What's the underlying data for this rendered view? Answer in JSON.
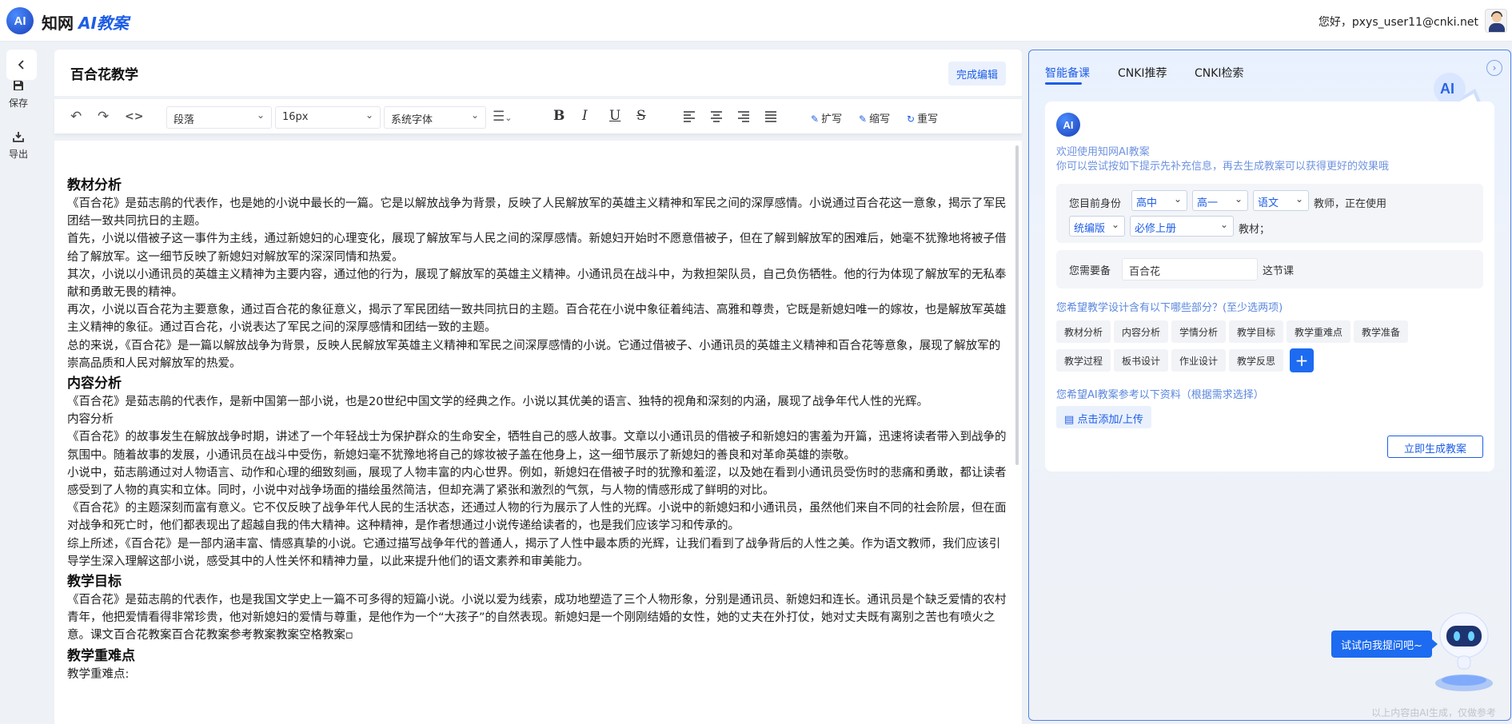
{
  "header": {
    "brand_cn": "知网",
    "brand_ai": "AI",
    "brand_suffix": "教案",
    "logo_text": "AI",
    "greeting": "您好，pxys_user11@cnki.net"
  },
  "leftrail": {
    "back": "<",
    "items": [
      {
        "label": "保存"
      },
      {
        "label": "导出"
      }
    ]
  },
  "editor": {
    "title": "百合花教学",
    "done_label": "完成编辑",
    "toolbar": {
      "paragraph": "段落",
      "font_size": "16px",
      "font_family": "系统字体",
      "expand": "扩写",
      "shorten": "缩写",
      "rewrite": "重写"
    },
    "blocks": [
      {
        "type": "h",
        "text": "教材分析"
      },
      {
        "type": "p",
        "text": "《百合花》是茹志鹃的代表作，也是她的小说中最长的一篇。它是以解放战争为背景，反映了人民解放军的英雄主义精神和军民之间的深厚感情。小说通过百合花这一意象，揭示了军民团结一致共同抗日的主题。"
      },
      {
        "type": "p",
        "text": "首先，小说以借被子这一事件为主线，通过新媳妇的心理变化，展现了解放军与人民之间的深厚感情。新媳妇开始时不愿意借被子，但在了解到解放军的困难后，她毫不犹豫地将被子借给了解放军。这一细节反映了新媳妇对解放军的深深同情和热爱。"
      },
      {
        "type": "p",
        "text": "其次，小说以小通讯员的英雄主义精神为主要内容，通过他的行为，展现了解放军的英雄主义精神。小通讯员在战斗中，为救担架队员，自己负伤牺牲。他的行为体现了解放军的无私奉献和勇敢无畏的精神。"
      },
      {
        "type": "p",
        "text": "再次，小说以百合花为主要意象，通过百合花的象征意义，揭示了军民团结一致共同抗日的主题。百合花在小说中象征着纯洁、高雅和尊贵，它既是新媳妇唯一的嫁妆，也是解放军英雄主义精神的象征。通过百合花，小说表达了军民之间的深厚感情和团结一致的主题。"
      },
      {
        "type": "p",
        "text": "总的来说，《百合花》是一篇以解放战争为背景，反映人民解放军英雄主义精神和军民之间深厚感情的小说。它通过借被子、小通讯员的英雄主义精神和百合花等意象，展现了解放军的崇高品质和人民对解放军的热爱。"
      },
      {
        "type": "h",
        "text": "内容分析"
      },
      {
        "type": "p",
        "text": "《百合花》是茹志鹃的代表作，是新中国第一部小说，也是20世纪中国文学的经典之作。小说以其优美的语言、独特的视角和深刻的内涵，展现了战争年代人性的光辉。"
      },
      {
        "type": "p",
        "text": "内容分析"
      },
      {
        "type": "p",
        "text": "《百合花》的故事发生在解放战争时期，讲述了一个年轻战士为保护群众的生命安全，牺牲自己的感人故事。文章以小通讯员的借被子和新媳妇的害羞为开篇，迅速将读者带入到战争的氛围中。随着故事的发展，小通讯员在战斗中受伤，新媳妇毫不犹豫地将自己的嫁妆被子盖在他身上，这一细节展示了新媳妇的善良和对革命英雄的崇敬。"
      },
      {
        "type": "p",
        "text": "小说中，茹志鹃通过对人物语言、动作和心理的细致刻画，展现了人物丰富的内心世界。例如，新媳妇在借被子时的犹豫和羞涩，以及她在看到小通讯员受伤时的悲痛和勇敢，都让读者感受到了人物的真实和立体。同时，小说中对战争场面的描绘虽然简洁，但却充满了紧张和激烈的气氛，与人物的情感形成了鲜明的对比。"
      },
      {
        "type": "p",
        "text": "《百合花》的主题深刻而富有意义。它不仅反映了战争年代人民的生活状态，还通过人物的行为展示了人性的光辉。小说中的新媳妇和小通讯员，虽然他们来自不同的社会阶层，但在面对战争和死亡时，他们都表现出了超越自我的伟大精神。这种精神，是作者想通过小说传递给读者的，也是我们应该学习和传承的。"
      },
      {
        "type": "p",
        "text": "综上所述，《百合花》是一部内涵丰富、情感真挚的小说。它通过描写战争年代的普通人，揭示了人性中最本质的光辉，让我们看到了战争背后的人性之美。作为语文教师，我们应该引导学生深入理解这部小说，感受其中的人性关怀和精神力量，以此来提升他们的语文素养和审美能力。"
      },
      {
        "type": "h",
        "text": "教学目标"
      },
      {
        "type": "p",
        "text": "《百合花》是茹志鹃的代表作，也是我国文学史上一篇不可多得的短篇小说。小说以爱为线索，成功地塑造了三个人物形象，分别是通讯员、新媳妇和连长。通讯员是个缺乏爱情的农村青年，他把爱情看得非常珍贵，他对新媳妇的爱情与尊重，是他作为一个“大孩子”的自然表现。新媳妇是一个刚刚结婚的女性，她的丈夫在外打仗，她对丈夫既有离别之苦也有喷火之意。课文百合花教案百合花教案参考教案教案空格教案▫"
      },
      {
        "type": "h",
        "text": "教学重难点"
      },
      {
        "type": "p",
        "text": "教学重难点:"
      }
    ]
  },
  "panel": {
    "tabs": [
      "智能备课",
      "CNKI推荐",
      "CNKI检索"
    ],
    "badge": "AI",
    "welcome_line1": "欢迎使用知网AI教案",
    "welcome_line2": "你可以尝试按如下提示先补充信息，再去生成教案可以获得更好的效果哦",
    "identity_prefix": "您目前身份",
    "stage": "高中",
    "grade": "高一",
    "subject": "语文",
    "identity_suffix": "教师，正在使用",
    "edition": "统编版",
    "volume": "必修上册",
    "material_suffix": "教材；",
    "prepare_prefix": "您需要备",
    "lesson": "百合花",
    "prepare_suffix": "这节课",
    "parts_hint": "您希望教学设计含有以下哪些部分？(至少选两项)",
    "parts": [
      "教材分析",
      "内容分析",
      "学情分析",
      "教学目标",
      "教学重难点",
      "教学准备",
      "教学过程",
      "板书设计",
      "作业设计",
      "教学反思"
    ],
    "plus": "+",
    "ref_hint": "您希望AI教案参考以下资料（根据需求选择）",
    "upload_label": "点击添加/上传",
    "generate_label": "立即生成教案",
    "ask_label": "试试向我提问吧~",
    "disclaimer": "以上内容由AI生成，仅做参考",
    "robot_text": "AI"
  },
  "colors": {
    "accent": "#1d5de6",
    "hint": "#5a87de",
    "panel_border": "#4f83e8"
  }
}
